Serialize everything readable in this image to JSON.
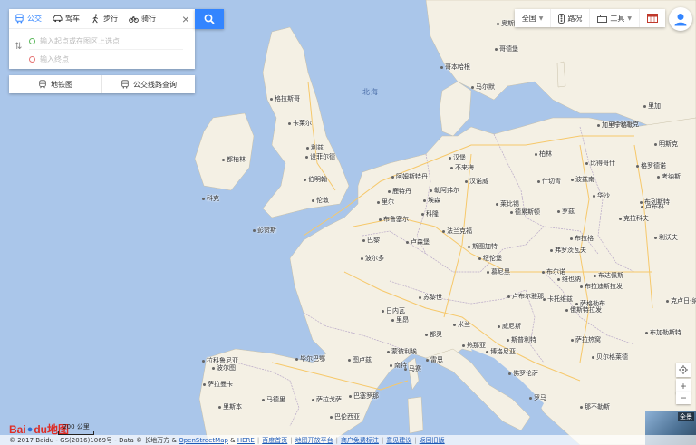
{
  "route_panel": {
    "modes": [
      {
        "label": "公交",
        "icon": "bus-icon",
        "active": true
      },
      {
        "label": "驾车",
        "icon": "car-icon",
        "active": false
      },
      {
        "label": "步行",
        "icon": "walk-icon",
        "active": false
      },
      {
        "label": "骑行",
        "icon": "bike-icon",
        "active": false
      }
    ],
    "start_placeholder": "输入起点或在图区上选点",
    "end_placeholder": "输入终点"
  },
  "links": {
    "subway": "地铁图",
    "bus_lines": "公交线路查询"
  },
  "toolbar": {
    "region": "全国",
    "traffic": "路况",
    "tools": "工具"
  },
  "map": {
    "sea_label": "北海",
    "cities": [
      {
        "name": "哥德堡"
      },
      {
        "name": "哥本哈根"
      },
      {
        "name": "马尔默"
      },
      {
        "name": "格拉斯哥"
      },
      {
        "name": "卡莱尔"
      },
      {
        "name": "利兹"
      },
      {
        "name": "设菲尔德"
      },
      {
        "name": "伯明翰"
      },
      {
        "name": "伦敦"
      },
      {
        "name": "都柏林"
      },
      {
        "name": "科克"
      },
      {
        "name": "彭赞斯"
      },
      {
        "name": "阿姆斯特丹"
      },
      {
        "name": "鹿特丹"
      },
      {
        "name": "汉堡"
      },
      {
        "name": "不来梅"
      },
      {
        "name": "汉诺威"
      },
      {
        "name": "埃森"
      },
      {
        "name": "科隆"
      },
      {
        "name": "布鲁塞尔"
      },
      {
        "name": "里尔"
      },
      {
        "name": "巴黎"
      },
      {
        "name": "卢森堡"
      },
      {
        "name": "法兰克福"
      },
      {
        "name": "斯图加特"
      },
      {
        "name": "柏林"
      },
      {
        "name": "莱比锡"
      },
      {
        "name": "德累斯顿"
      },
      {
        "name": "纽伦堡"
      },
      {
        "name": "慕尼黑"
      },
      {
        "name": "维也纳"
      },
      {
        "name": "布拉迪斯拉发"
      },
      {
        "name": "格但斯克"
      },
      {
        "name": "什切青"
      },
      {
        "name": "比得哥什"
      },
      {
        "name": "波兹南"
      },
      {
        "name": "华沙"
      },
      {
        "name": "罗兹"
      },
      {
        "name": "弗罗茨瓦夫"
      },
      {
        "name": "克拉科夫"
      },
      {
        "name": "卢布林"
      },
      {
        "name": "利沃夫"
      },
      {
        "name": "布拉格"
      },
      {
        "name": "布尔诺"
      },
      {
        "name": "俄斯特拉发"
      },
      {
        "name": "卡托维兹"
      },
      {
        "name": "苏黎世"
      },
      {
        "name": "日内瓦"
      },
      {
        "name": "米兰"
      },
      {
        "name": "都灵"
      },
      {
        "name": "热那亚"
      },
      {
        "name": "威尼斯"
      },
      {
        "name": "博洛尼亚"
      },
      {
        "name": "佛罗伦萨"
      },
      {
        "name": "罗马"
      },
      {
        "name": "那不勒斯"
      },
      {
        "name": "里昂"
      },
      {
        "name": "波尔多"
      },
      {
        "name": "图卢兹"
      },
      {
        "name": "马赛"
      },
      {
        "name": "蒙彼利埃"
      },
      {
        "name": "巴塞罗那"
      },
      {
        "name": "萨拉戈萨"
      },
      {
        "name": "毕尔巴鄂"
      },
      {
        "name": "马德里"
      },
      {
        "name": "巴伦西亚"
      },
      {
        "name": "萨拉曼卡"
      },
      {
        "name": "波尔图"
      },
      {
        "name": "里斯本"
      },
      {
        "name": "拉科鲁尼亚"
      },
      {
        "name": "南特"
      },
      {
        "name": "雷恩"
      },
      {
        "name": "勒阿弗尔"
      },
      {
        "name": "卢布尔雅那"
      },
      {
        "name": "萨格勒布"
      },
      {
        "name": "布达佩斯"
      },
      {
        "name": "萨拉热窝"
      },
      {
        "name": "贝尔格莱德"
      },
      {
        "name": "斯普利特"
      },
      {
        "name": "布加勒斯特"
      },
      {
        "name": "克卢日-纳波卡"
      },
      {
        "name": "考纳斯"
      },
      {
        "name": "维尔纽斯"
      },
      {
        "name": "加里宁格勒"
      },
      {
        "name": "明斯克"
      },
      {
        "name": "里加"
      },
      {
        "name": "奥斯陆"
      },
      {
        "name": "格罗德诺"
      },
      {
        "name": "布列斯特"
      }
    ]
  },
  "controls": {
    "thumbnail_label": "全景"
  },
  "logo": {
    "text_a": "Bai",
    "text_b": "du",
    "text_c": "地图"
  },
  "scale": {
    "label": "200 公里"
  },
  "footer": {
    "copyright": "© 2017 Baidu - GS(2016)1069号 - Data © 长地万方 &",
    "osm": "OpenStreetMap",
    "amp": "&",
    "here": "HERE",
    "links": [
      "百度首页",
      "地图开放平台",
      "商户免费标注",
      "意见建议",
      "返回旧版"
    ]
  }
}
